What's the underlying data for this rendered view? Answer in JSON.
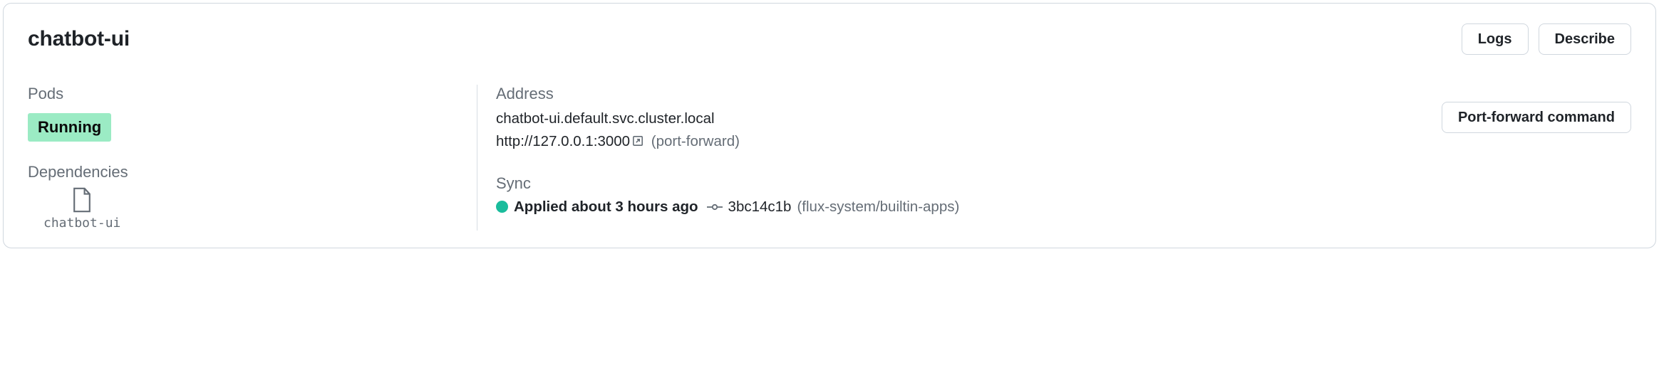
{
  "header": {
    "title": "chatbot-ui",
    "logs_label": "Logs",
    "describe_label": "Describe"
  },
  "pods": {
    "label": "Pods",
    "status": "Running"
  },
  "dependencies": {
    "label": "Dependencies",
    "items": [
      {
        "name": "chatbot-ui"
      }
    ]
  },
  "address": {
    "label": "Address",
    "dns": "chatbot-ui.default.svc.cluster.local",
    "url": "http://127.0.0.1:3000",
    "note": "(port-forward)",
    "pf_button": "Port-forward command"
  },
  "sync": {
    "label": "Sync",
    "status_text": "Applied about 3 hours ago",
    "commit": "3bc14c1b",
    "source": "(flux-system/builtin-apps)",
    "status_color": "#1abc9c"
  }
}
